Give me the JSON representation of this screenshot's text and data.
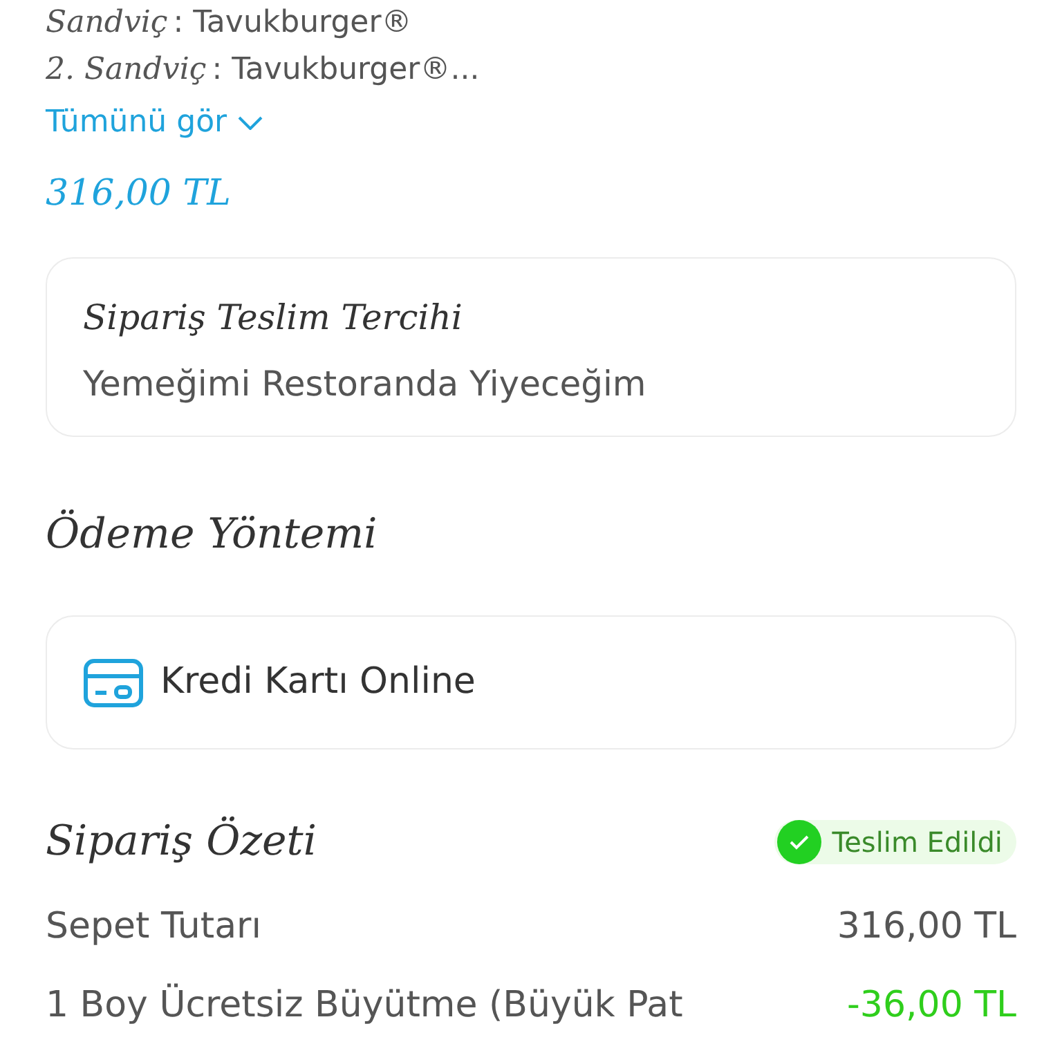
{
  "items": [
    {
      "label": "Sandviç",
      "value": ": Tavukburger®"
    },
    {
      "label": "2. Sandviç",
      "value": ": Tavukburger®..."
    }
  ],
  "see_all": {
    "label": "Tümünü gör",
    "expanded": false
  },
  "item_total": "316,00 TL",
  "delivery": {
    "title": "Sipariş Teslim Tercihi",
    "value": "Yemeğimi Restoranda Yiyeceğim"
  },
  "payment": {
    "title": "Ödeme Yöntemi",
    "method": "Kredi Kartı Online"
  },
  "summary": {
    "title": "Sipariş Özeti",
    "status": "Teslim Edildi",
    "rows": [
      {
        "label": "Sepet Tutarı",
        "amount": "316,00 TL",
        "kind": "charge"
      },
      {
        "label": "1 Boy Ücretsiz Büyütme (Büyük Pat",
        "amount": "-36,00 TL",
        "kind": "discount"
      }
    ]
  }
}
